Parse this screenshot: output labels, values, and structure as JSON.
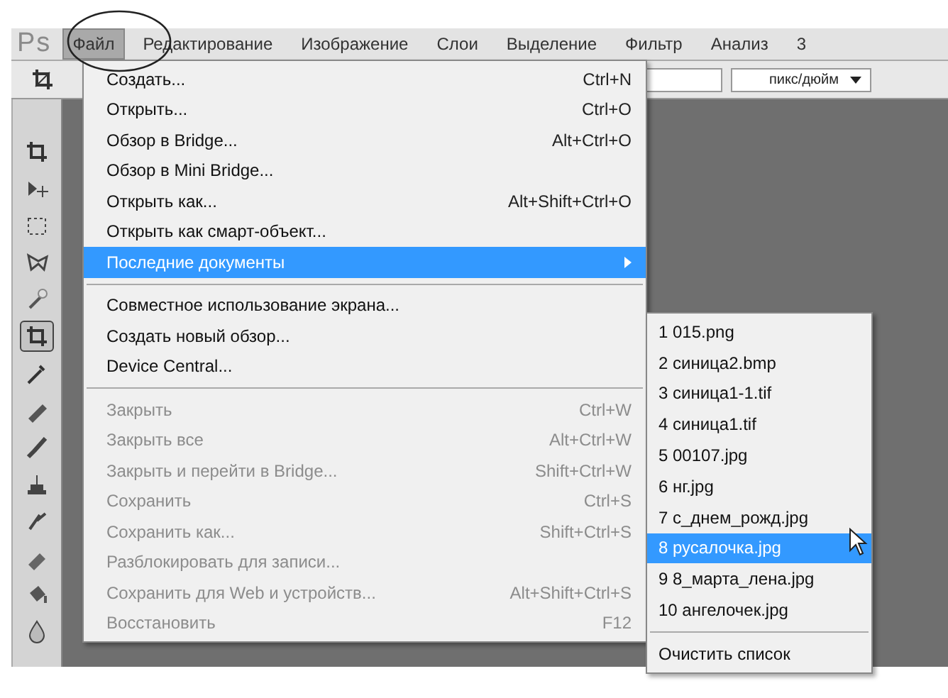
{
  "menubar": {
    "logo": "Ps",
    "items": [
      {
        "label": "Файл",
        "selected": true
      },
      {
        "label": "Редактирование",
        "selected": false
      },
      {
        "label": "Изображение",
        "selected": false
      },
      {
        "label": "Слои",
        "selected": false
      },
      {
        "label": "Выделение",
        "selected": false
      },
      {
        "label": "Фильтр",
        "selected": false
      },
      {
        "label": "Анализ",
        "selected": false
      },
      {
        "label": "3",
        "selected": false
      }
    ]
  },
  "options_bar": {
    "unit_dropdown": "пикс/дюйм"
  },
  "tools": [
    {
      "selected": false
    },
    {
      "selected": false
    },
    {
      "selected": false
    },
    {
      "selected": false
    },
    {
      "selected": false
    },
    {
      "selected": true
    },
    {
      "selected": false
    },
    {
      "selected": false
    },
    {
      "selected": false
    },
    {
      "selected": false
    },
    {
      "selected": false
    },
    {
      "selected": false
    },
    {
      "selected": false
    },
    {
      "selected": false
    }
  ],
  "file_menu": [
    {
      "kind": "item",
      "label": "Создать...",
      "shortcut": "Ctrl+N",
      "disabled": false,
      "selected": false
    },
    {
      "kind": "item",
      "label": "Открыть...",
      "shortcut": "Ctrl+O",
      "disabled": false,
      "selected": false
    },
    {
      "kind": "item",
      "label": "Обзор в Bridge...",
      "shortcut": "Alt+Ctrl+O",
      "disabled": false,
      "selected": false
    },
    {
      "kind": "item",
      "label": "Обзор в Mini Bridge...",
      "disabled": false,
      "selected": false
    },
    {
      "kind": "item",
      "label": "Открыть как...",
      "shortcut": "Alt+Shift+Ctrl+O",
      "disabled": false,
      "selected": false
    },
    {
      "kind": "item",
      "label": "Открыть как смарт-объект...",
      "disabled": false,
      "selected": false
    },
    {
      "kind": "item",
      "label": "Последние документы",
      "disabled": false,
      "selected": true,
      "submenu": true
    },
    {
      "kind": "separator"
    },
    {
      "kind": "item",
      "label": "Совместное использование экрана...",
      "disabled": false,
      "selected": false
    },
    {
      "kind": "item",
      "label": "Создать новый обзор...",
      "disabled": false,
      "selected": false
    },
    {
      "kind": "item",
      "label": "Device Central...",
      "disabled": false,
      "selected": false
    },
    {
      "kind": "separator"
    },
    {
      "kind": "item",
      "label": "Закрыть",
      "shortcut": "Ctrl+W",
      "disabled": true,
      "selected": false
    },
    {
      "kind": "item",
      "label": "Закрыть все",
      "shortcut": "Alt+Ctrl+W",
      "disabled": true,
      "selected": false
    },
    {
      "kind": "item",
      "label": "Закрыть и перейти в Bridge...",
      "shortcut": "Shift+Ctrl+W",
      "disabled": true,
      "selected": false
    },
    {
      "kind": "item",
      "label": "Сохранить",
      "shortcut": "Ctrl+S",
      "disabled": true,
      "selected": false
    },
    {
      "kind": "item",
      "label": "Сохранить как...",
      "shortcut": "Shift+Ctrl+S",
      "disabled": true,
      "selected": false
    },
    {
      "kind": "item",
      "label": "Разблокировать для записи...",
      "disabled": true,
      "selected": false
    },
    {
      "kind": "item",
      "label": "Сохранить для Web и устройств...",
      "shortcut": "Alt+Shift+Ctrl+S",
      "disabled": true,
      "selected": false
    },
    {
      "kind": "item",
      "label": "Восстановить",
      "shortcut": "F12",
      "disabled": true,
      "selected": false
    }
  ],
  "recent_menu": [
    {
      "kind": "item",
      "label": "1 015.png",
      "selected": false
    },
    {
      "kind": "item",
      "label": "2 синица2.bmp",
      "selected": false
    },
    {
      "kind": "item",
      "label": "3 синица1-1.tif",
      "selected": false
    },
    {
      "kind": "item",
      "label": "4 синица1.tif",
      "selected": false
    },
    {
      "kind": "item",
      "label": "5 00107.jpg",
      "selected": false
    },
    {
      "kind": "item",
      "label": "6 нг.jpg",
      "selected": false
    },
    {
      "kind": "item",
      "label": "7 с_днем_рожд.jpg",
      "selected": false
    },
    {
      "kind": "item",
      "label": "8 русалочка.jpg",
      "selected": true
    },
    {
      "kind": "item",
      "label": "9 8_марта_лена.jpg",
      "selected": false
    },
    {
      "kind": "item",
      "label": "10 ангелочек.jpg",
      "selected": false
    },
    {
      "kind": "separator"
    },
    {
      "kind": "item",
      "label": "Очистить список",
      "selected": false
    }
  ]
}
